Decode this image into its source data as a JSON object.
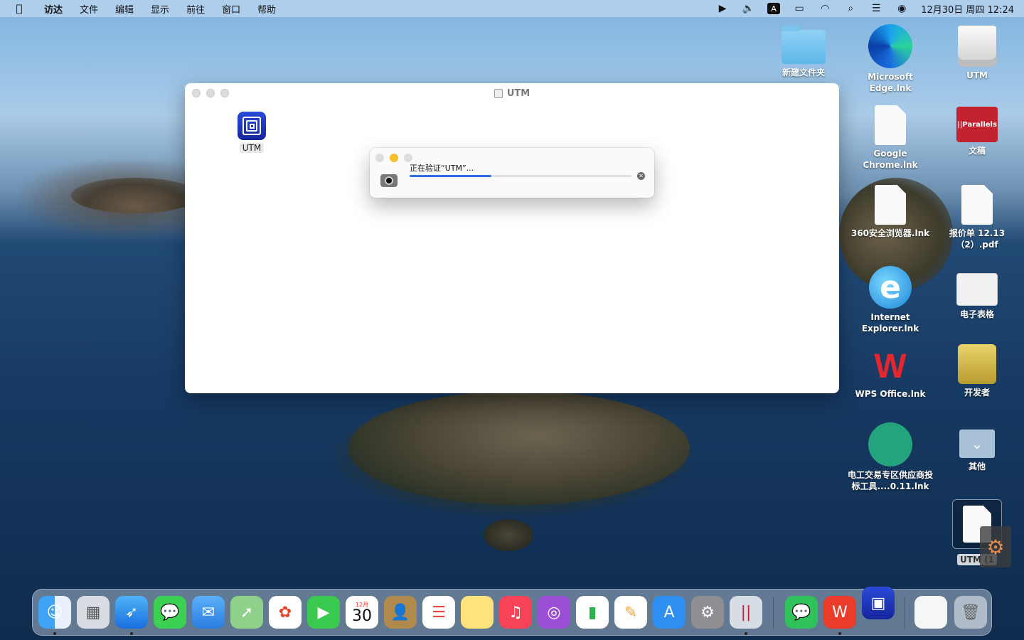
{
  "menubar": {
    "app_name": "访达",
    "items": [
      "文件",
      "编辑",
      "显示",
      "前往",
      "窗口",
      "帮助"
    ],
    "input_method": "A",
    "datetime": "12月30日 周四  12:24"
  },
  "finder_window": {
    "title": "UTM",
    "file_label": "UTM"
  },
  "verify_dialog": {
    "message": "正在验证“UTM”...",
    "progress": 0.37
  },
  "desktop": {
    "new_folder": "新建文件夹",
    "edge": "Microsoft Edge.lnk",
    "utm_disk": "UTM",
    "chrome": "Google Chrome.lnk",
    "parallels": "文稿",
    "qh360": "360安全浏览器.lnk",
    "quote_pdf": "报价单 12.13（2）.pdf",
    "ie": "Internet Explorer.lnk",
    "spreadsheet": "电子表格",
    "wps": "WPS Office.lnk",
    "developer": "开发者",
    "trade_tool": "电工交易专区供应商投标工具....0.11.lnk",
    "other": "其他",
    "utm_doc": "UTM (1"
  },
  "dock": {
    "calendar_month": "12月",
    "calendar_day": "30"
  }
}
